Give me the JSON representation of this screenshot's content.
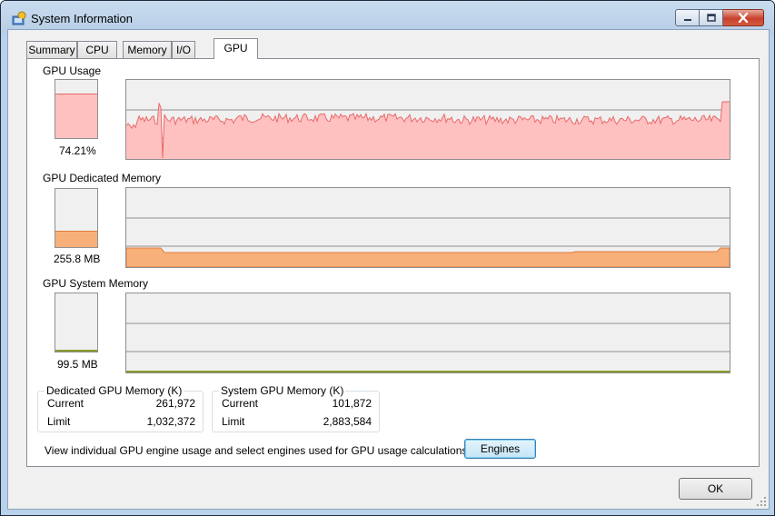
{
  "window": {
    "title": "System Information",
    "icon": "system-information-icon",
    "controls": {
      "minimize": "minimize-icon",
      "maximize": "maximize-icon",
      "close": "close-icon"
    }
  },
  "tabs": [
    {
      "label": "Summary",
      "active": false
    },
    {
      "label": "CPU",
      "active": false
    },
    {
      "label": "Memory",
      "active": false
    },
    {
      "label": "I/O",
      "active": false
    },
    {
      "label": "GPU",
      "active": true
    }
  ],
  "sections": {
    "usage": {
      "label": "GPU Usage",
      "value": "74.21%",
      "level_percent": 74.21
    },
    "dedicated": {
      "label": "GPU Dedicated Memory",
      "value": "255.8 MB"
    },
    "system": {
      "label": "GPU System Memory",
      "value": "99.5 MB"
    }
  },
  "dedicated_box": {
    "title": "Dedicated GPU Memory (K)",
    "current_label": "Current",
    "current_value": "261,972",
    "limit_label": "Limit",
    "limit_value": "1,032,372"
  },
  "system_box": {
    "title": "System GPU Memory (K)",
    "current_label": "Current",
    "current_value": "101,872",
    "limit_label": "Limit",
    "limit_value": "2,883,584"
  },
  "engines": {
    "description": "View individual GPU engine usage and select engines used for GPU usage calculations:",
    "button_label": "Engines"
  },
  "ok_button": "OK",
  "colors": {
    "usage_fill": "#ffc0c0",
    "usage_line": "#e86a6a",
    "dedicated_fill": "#f8b07a",
    "dedicated_line": "#e07a40",
    "system_line": "#8a9a2a",
    "graph_bg": "#f0f0f0"
  }
}
